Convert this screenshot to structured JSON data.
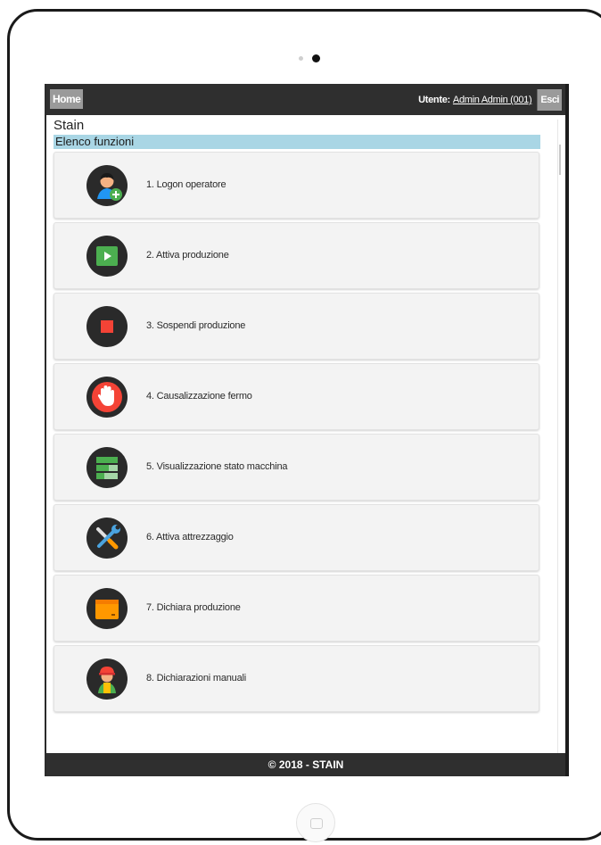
{
  "device": {
    "camera_icon": "camera-dots-icon",
    "home_button_icon": "tablet-home-button-icon"
  },
  "topbar": {
    "home_label": "Home",
    "user_prefix": "Utente:",
    "user_name": "Admin Admin (001)",
    "exit_label": "Esci"
  },
  "app": {
    "title": "Stain",
    "section_title": "Elenco funzioni"
  },
  "menu": {
    "items": [
      {
        "label": "1. Logon operatore",
        "icon": "operator-add-icon"
      },
      {
        "label": "2. Attiva produzione",
        "icon": "play-icon"
      },
      {
        "label": "3. Sospendi produzione",
        "icon": "stop-icon"
      },
      {
        "label": "4. Causalizzazione fermo",
        "icon": "hand-stop-icon"
      },
      {
        "label": "5. Visualizzazione stato macchina",
        "icon": "machine-status-icon"
      },
      {
        "label": "6. Attiva attrezzaggio",
        "icon": "tools-icon"
      },
      {
        "label": "7. Dichiara produzione",
        "icon": "box-icon"
      },
      {
        "label": "8. Dichiarazioni manuali",
        "icon": "worker-icon"
      }
    ]
  },
  "footer": {
    "text": "© 2018 - STAIN"
  },
  "colors": {
    "bar": "#2f2f2f",
    "section_header": "#a9d6e5",
    "button_grey": "#9a9a9a",
    "play_green": "#4caf50",
    "stop_red": "#f44336",
    "box_orange": "#ff9800"
  }
}
